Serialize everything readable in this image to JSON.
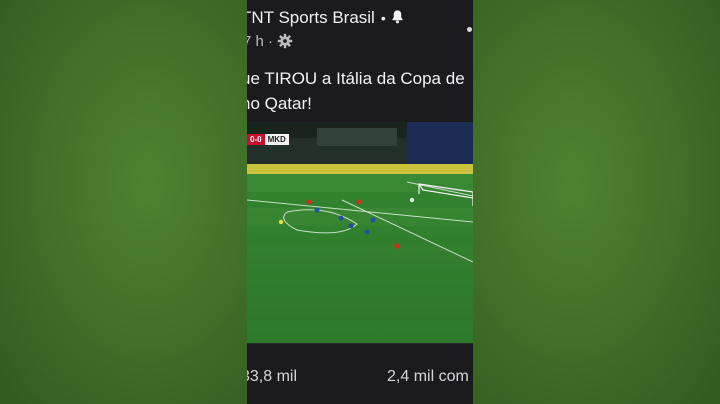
{
  "post": {
    "channel_name": "TNT Sports Brasil",
    "separator": "•",
    "time_ago": "7 h ·",
    "caption_line1": "ue TIROU a Itália da Copa de",
    "caption_line2": "no Qatar!"
  },
  "video": {
    "score": "0-0",
    "opponent": "MKD"
  },
  "stats": {
    "likes": "33,8 mil",
    "comments": "2,4 mil com"
  },
  "colors": {
    "background_green": "#3f6a28",
    "panel_dark": "#1b1b1e",
    "pitch_green": "#2f7a2c",
    "score_red": "#c8102e",
    "italy_blue": "#1f4fa8",
    "macedonia_red": "#d52b1e"
  },
  "icons": [
    "bell-icon",
    "gear-icon",
    "more-options-icon"
  ]
}
